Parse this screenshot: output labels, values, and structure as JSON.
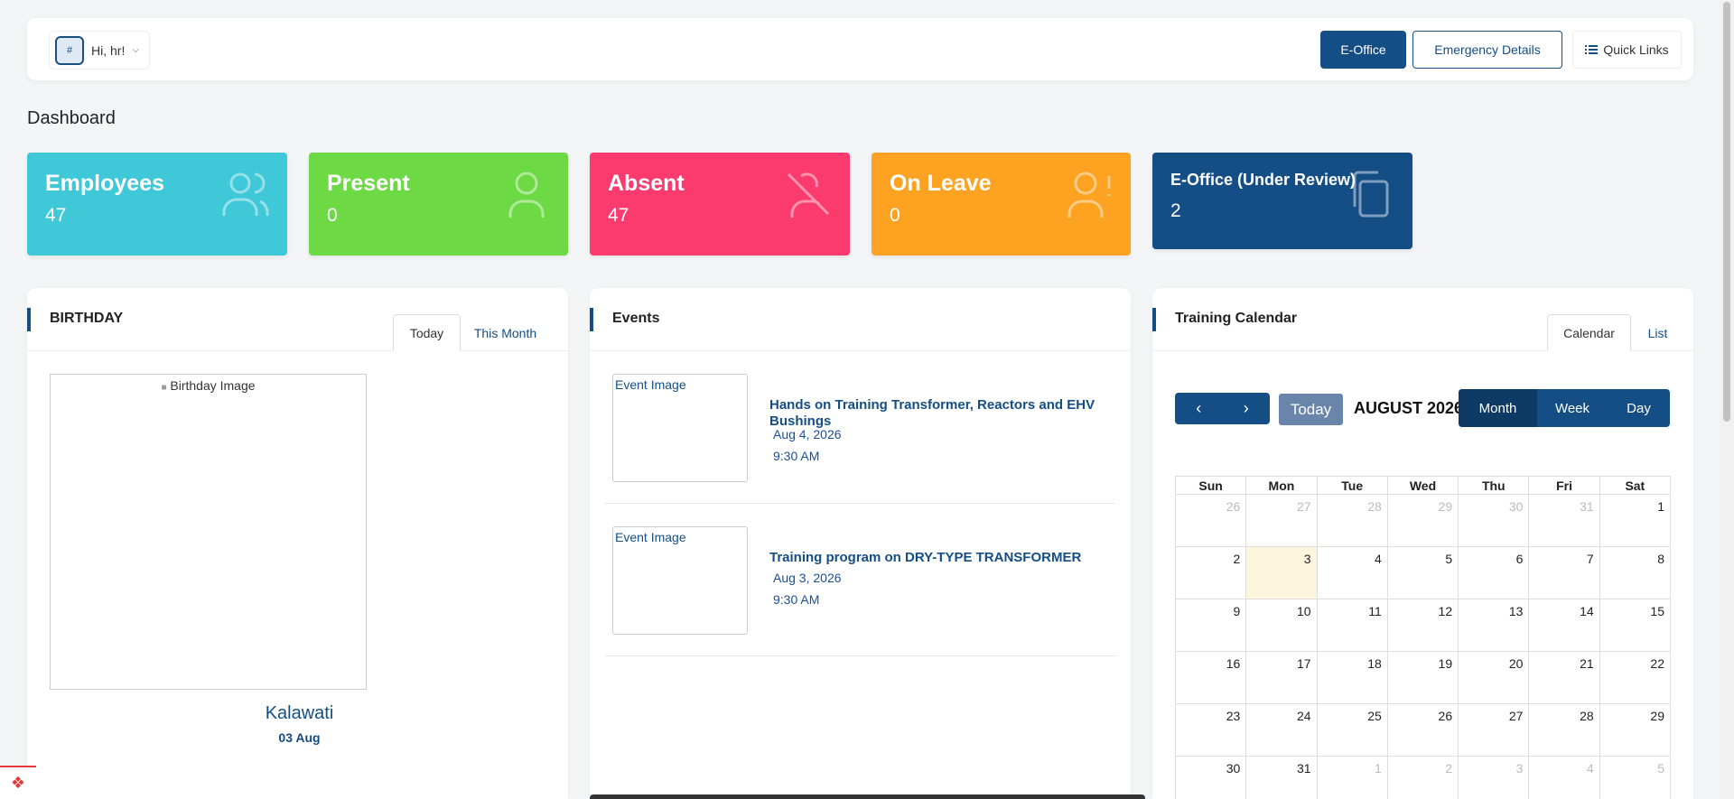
{
  "header": {
    "user_greeting": "Hi, hr!",
    "avatar_alt": "#",
    "eoffice_label": "E-Office",
    "emergency_label": "Emergency Details",
    "quicklinks_label": "Quick Links"
  },
  "page_title": "Dashboard",
  "stats": [
    {
      "label": "Employees",
      "value": "47",
      "icon": "users-icon",
      "color": "#3ec8d8"
    },
    {
      "label": "Present",
      "value": "0",
      "icon": "user-icon",
      "color": "#6dd944"
    },
    {
      "label": "Absent",
      "value": "47",
      "icon": "user-off-icon",
      "color": "#fb3a6e"
    },
    {
      "label": "On Leave",
      "value": "0",
      "icon": "user-leave-icon",
      "color": "#fda221"
    },
    {
      "label": "E-Office (Under Review)",
      "value": "2",
      "icon": "copy-icon",
      "color": "#144e85"
    }
  ],
  "birthday": {
    "title": "BIRTHDAY",
    "tabs": [
      "Today",
      "This Month"
    ],
    "image_alt": "Birthday Image",
    "name": "Kalawati",
    "date": "03 Aug"
  },
  "events": {
    "title": "Events",
    "items": [
      {
        "image_alt": "Event Image",
        "title": "Hands on Training Transformer, Reactors and EHV Bushings",
        "date": "Aug 4, 2026",
        "time": "9:30 AM"
      },
      {
        "image_alt": "Event Image",
        "title": "Training program on DRY-TYPE TRANSFORMER",
        "date": "Aug 3, 2026",
        "time": "9:30 AM"
      }
    ]
  },
  "training": {
    "title": "Training Calendar",
    "tabs": [
      "Calendar",
      "List"
    ],
    "today_label": "Today",
    "month_title": "AUGUST 2026",
    "views": [
      "Month",
      "Week",
      "Day"
    ],
    "weekdays": [
      "Sun",
      "Mon",
      "Tue",
      "Wed",
      "Thu",
      "Fri",
      "Sat"
    ],
    "weeks": [
      [
        "26",
        "27",
        "28",
        "29",
        "30",
        "31",
        "1"
      ],
      [
        "2",
        "3",
        "4",
        "5",
        "6",
        "7",
        "8"
      ],
      [
        "9",
        "10",
        "11",
        "12",
        "13",
        "14",
        "15"
      ],
      [
        "16",
        "17",
        "18",
        "19",
        "20",
        "21",
        "22"
      ],
      [
        "23",
        "24",
        "25",
        "26",
        "27",
        "28",
        "29"
      ],
      [
        "30",
        "31",
        "1",
        "2",
        "3",
        "4",
        "5"
      ]
    ],
    "today_day": "3"
  }
}
